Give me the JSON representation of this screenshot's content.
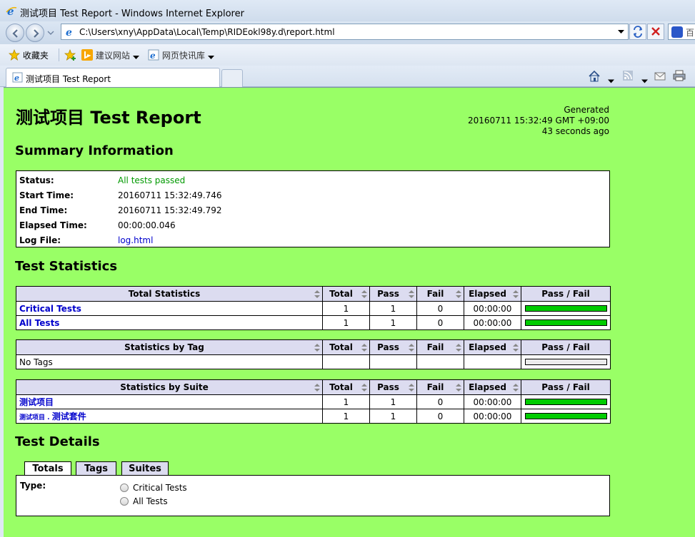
{
  "window": {
    "title": "测试项目 Test Report - Windows Internet Explorer",
    "address": "C:\\Users\\xny\\AppData\\Local\\Temp\\RIDEokl98y.d\\report.html",
    "search_text": "百"
  },
  "favorites_bar": {
    "favorites_label": "收藏夹",
    "suggested_sites_label": "建议网站",
    "web_slices_label": "网页快讯库"
  },
  "tab": {
    "label": "测试项目 Test Report"
  },
  "report": {
    "title": "测试项目 Test Report",
    "generated": {
      "label": "Generated",
      "timestamp": "20160711 15:32:49 GMT +09:00",
      "ago": "43 seconds ago"
    }
  },
  "summary": {
    "heading": "Summary Information",
    "rows": [
      {
        "label": "Status:",
        "value": "All tests passed"
      },
      {
        "label": "Start Time:",
        "value": "20160711 15:32:49.746"
      },
      {
        "label": "End Time:",
        "value": "20160711 15:32:49.792"
      },
      {
        "label": "Elapsed Time:",
        "value": "00:00:00.046"
      },
      {
        "label": "Log File:",
        "value": "log.html"
      }
    ]
  },
  "statistics": {
    "heading": "Test Statistics",
    "columns": [
      "Total",
      "Pass",
      "Fail",
      "Elapsed",
      "Pass / Fail"
    ],
    "total": {
      "header": "Total Statistics",
      "rows": [
        {
          "name": "Critical Tests",
          "total": "1",
          "pass": "1",
          "fail": "0",
          "elapsed": "00:00:00",
          "pass_fraction": 1
        },
        {
          "name": "All Tests",
          "total": "1",
          "pass": "1",
          "fail": "0",
          "elapsed": "00:00:00",
          "pass_fraction": 1
        }
      ]
    },
    "tag": {
      "header": "Statistics by Tag",
      "rows": [
        {
          "name": "No Tags"
        }
      ]
    },
    "suite": {
      "header": "Statistics by Suite",
      "rows": [
        {
          "name": "测试项目",
          "total": "1",
          "pass": "1",
          "fail": "0",
          "elapsed": "00:00:00",
          "pass_fraction": 1
        },
        {
          "parent": "测试项目 . ",
          "name": "测试套件",
          "total": "1",
          "pass": "1",
          "fail": "0",
          "elapsed": "00:00:00",
          "pass_fraction": 1
        }
      ]
    }
  },
  "details": {
    "heading": "Test Details",
    "tabs": [
      "Totals",
      "Tags",
      "Suites"
    ],
    "type_label": "Type:",
    "options": [
      "Critical Tests",
      "All Tests"
    ]
  }
}
